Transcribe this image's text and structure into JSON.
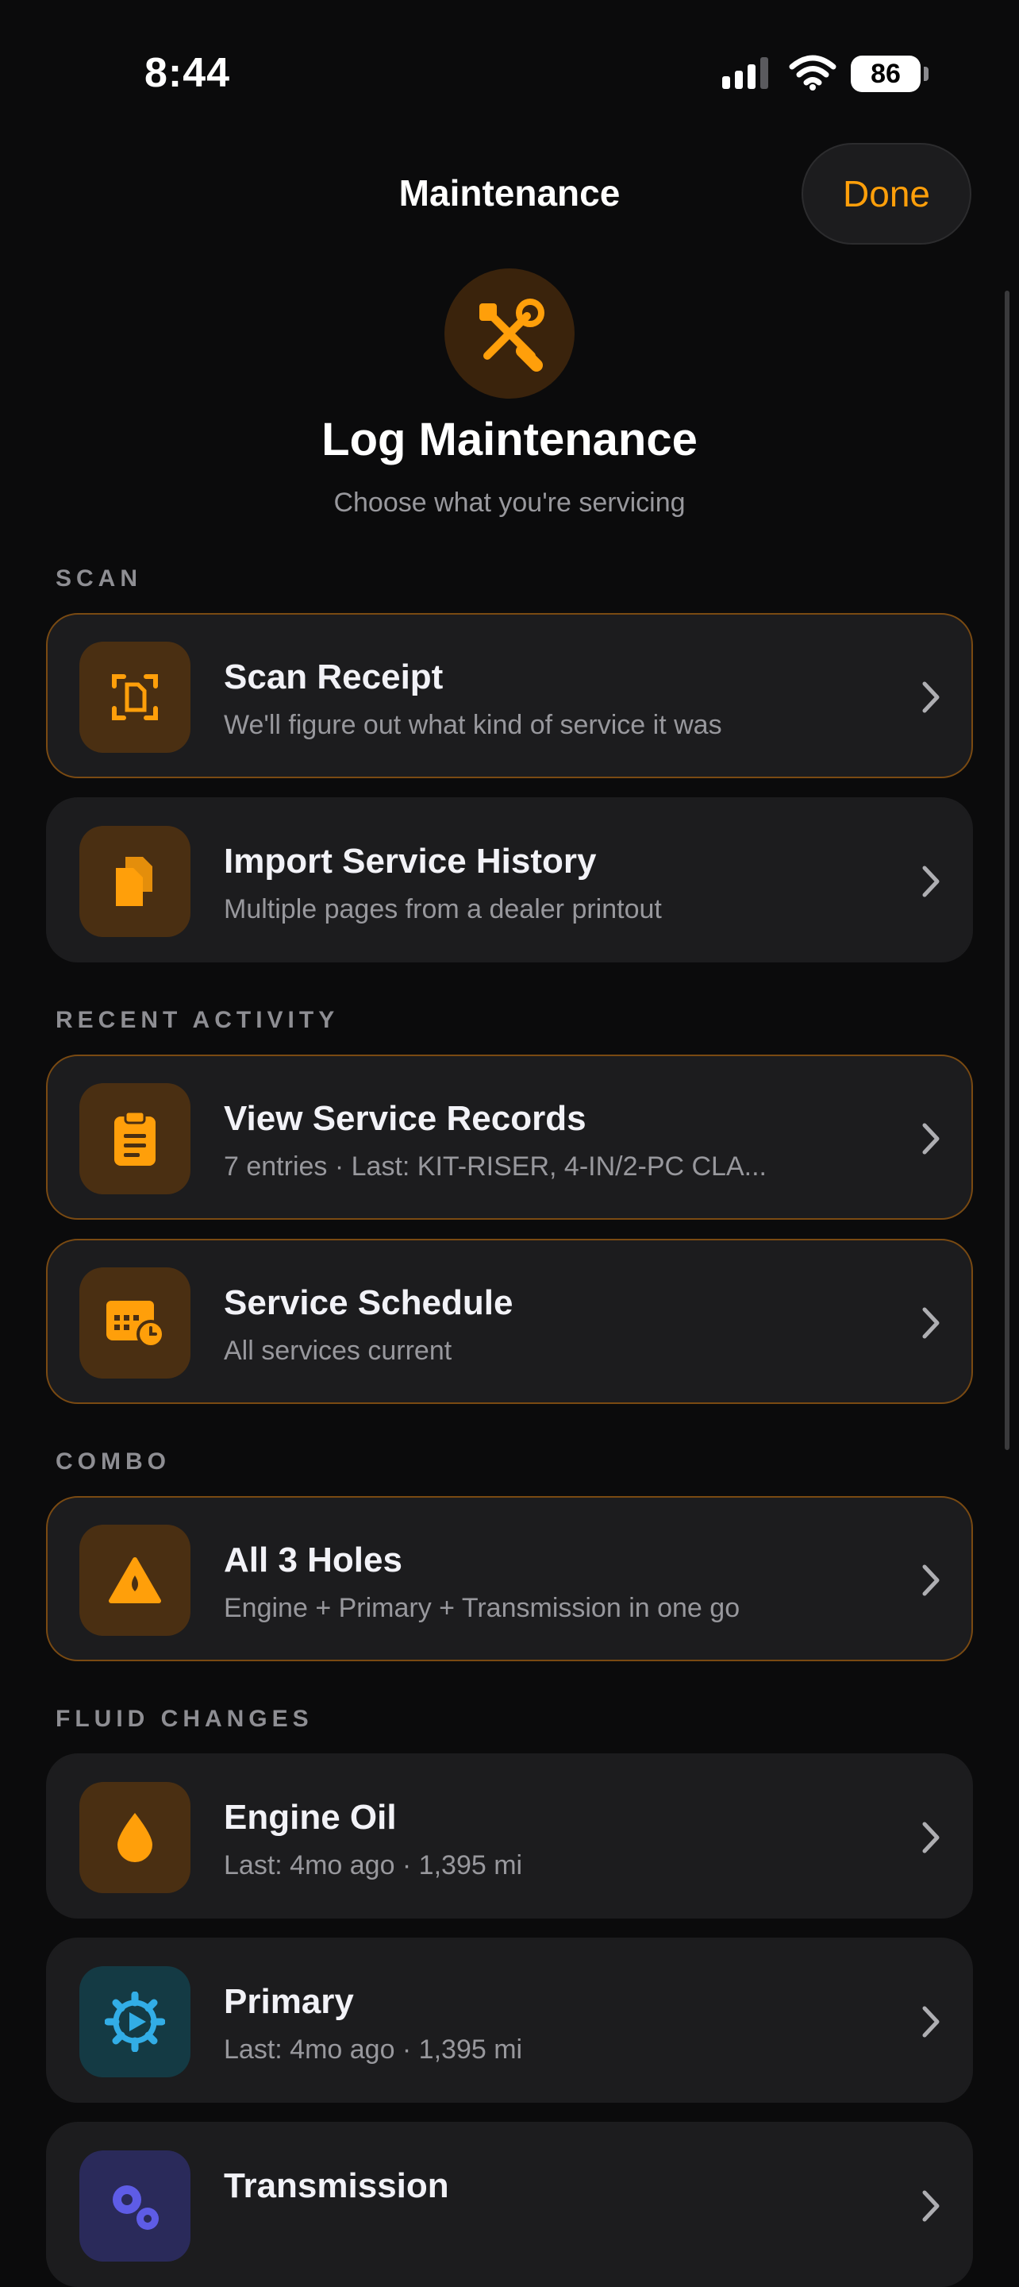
{
  "status_bar": {
    "time": "8:44",
    "battery": "86"
  },
  "nav": {
    "title": "Maintenance",
    "done_label": "Done"
  },
  "hero": {
    "title": "Log Maintenance",
    "subtitle": "Choose what you're servicing"
  },
  "sections": {
    "scan": "SCAN",
    "recent": "RECENT ACTIVITY",
    "combo": "COMBO",
    "fluid": "FLUID CHANGES"
  },
  "items": {
    "scan_receipt": {
      "title": "Scan Receipt",
      "subtitle": "We'll figure out what kind of service it was"
    },
    "import_history": {
      "title": "Import Service History",
      "subtitle": "Multiple pages from a dealer printout"
    },
    "view_records": {
      "title": "View Service Records",
      "subtitle": "7 entries · Last: KIT-RISER, 4-IN/2-PC CLA..."
    },
    "schedule": {
      "title": "Service Schedule",
      "subtitle": "All services current"
    },
    "all_three": {
      "title": "All 3 Holes",
      "subtitle": "Engine + Primary + Transmission in one go"
    },
    "engine_oil": {
      "title": "Engine Oil",
      "subtitle": "Last: 4mo ago · 1,395 mi"
    },
    "primary": {
      "title": "Primary",
      "subtitle": "Last: 4mo ago · 1,395 mi"
    },
    "transmission": {
      "title": "Transmission",
      "subtitle": ""
    }
  },
  "colors": {
    "accent": "#ff9f0a",
    "teal": "#32ade6",
    "indigo": "#5e5ce6",
    "background": "#0b0b0c",
    "card": "#1c1c1e"
  },
  "icons": {
    "hero": "wrench-screwdriver-icon",
    "scan_receipt": "doc-viewfinder-icon",
    "import_history": "doc-stack-icon",
    "view_records": "clipboard-icon",
    "schedule": "calendar-clock-icon",
    "all_three": "triangle-drop-icon",
    "engine_oil": "drop-icon",
    "primary": "gear-play-icon",
    "transmission": "gears-icon"
  }
}
